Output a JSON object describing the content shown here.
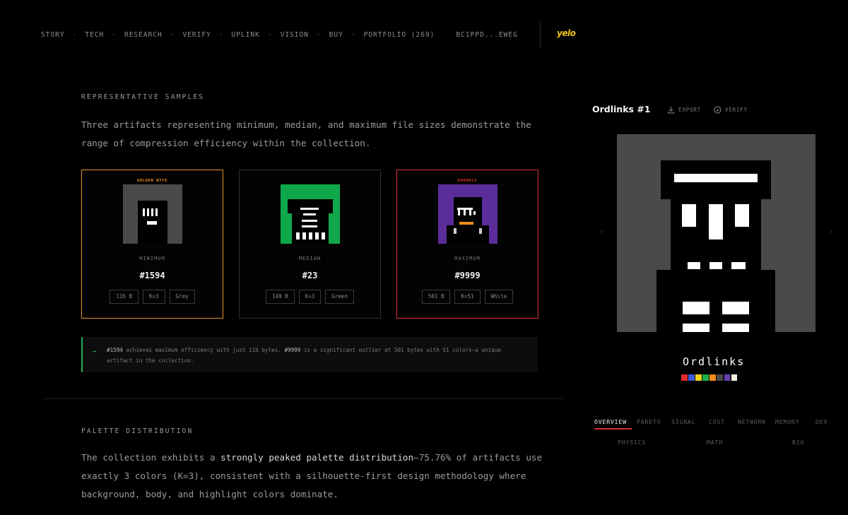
{
  "nav": {
    "items": [
      "STORY",
      "TECH",
      "RESEARCH",
      "VERIFY",
      "UPLINK",
      "VISION",
      "BUY",
      "PORTFOLIO (269)"
    ],
    "separator": "·",
    "wallet": "BC1PPD...EWEG",
    "logo": "yelo"
  },
  "samples": {
    "heading": "REPRESENTATIVE SAMPLES",
    "description": "Three artifacts representing minimum, median, and maximum file sizes demonstrate the range of compression efficiency within the collection.",
    "cards": [
      {
        "badge": "GOLDEN BYTE",
        "badge_color": "#f28c1b",
        "rank": "MINIMUM",
        "id": "#1594",
        "size": "116 B",
        "k": "K=3",
        "color": "Grey",
        "bg": "#4a4a4a"
      },
      {
        "badge": "",
        "badge_color": "",
        "rank": "MEDIAN",
        "id": "#23",
        "size": "149 B",
        "k": "K=3",
        "color": "Green",
        "bg": "#0ea84a"
      },
      {
        "badge": "ANOMALY",
        "badge_color": "#e52c2c",
        "rank": "MAXIMUM",
        "id": "#9999",
        "size": "501 B",
        "k": "K=51",
        "color": "White",
        "bg": "#5b2d9a"
      }
    ],
    "callout": {
      "arrow": "→",
      "id_a": "#1594",
      "text_a": " achieves maximum efficiency with just 116 bytes. ",
      "id_b": "#9999",
      "text_b": " is a significant outlier at 501 bytes with 51 colors—a unique artifact in the collection."
    }
  },
  "palette": {
    "heading": "PALETTE DISTRIBUTION",
    "text_a": "The collection exhibits a ",
    "emphasis": "strongly peaked palette distribution",
    "text_b": "—75.76% of artifacts use exactly 3 colors (K=3), consistent with a silhouette-first design methodology where background, body, and highlight colors dominate."
  },
  "panel": {
    "title": "Ordlinks #1",
    "export_label": "EXPORT",
    "verify_label": "VERIFY",
    "prev": "‹",
    "next": "›",
    "wordmark": "Ordlinks",
    "swatch_colors": [
      "#e52c2c",
      "#3b5bd6",
      "#f2d21b",
      "#1fb04f",
      "#f28c1b",
      "#4a4a4a",
      "#6b3fb0",
      "#f3efe0"
    ],
    "tabs": [
      "OVERVIEW",
      "PARETO",
      "SIGNAL",
      "COST",
      "NETWORK",
      "MEMORY",
      "DEV"
    ],
    "tabs_row2": [
      "PHYSICS",
      "MATH",
      "BIO"
    ]
  }
}
